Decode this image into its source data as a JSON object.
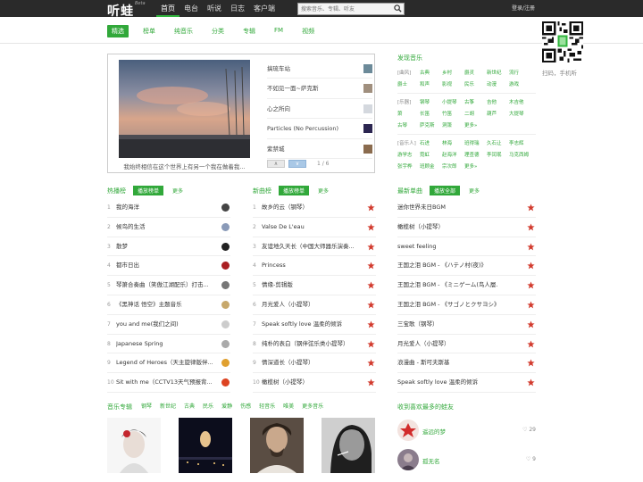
{
  "brand": {
    "logo": "听蛙",
    "beta": "Beta"
  },
  "topnav": [
    {
      "label": "首页",
      "active": true
    },
    {
      "label": "电台"
    },
    {
      "label": "听说"
    },
    {
      "label": "日志"
    },
    {
      "label": "客户端"
    }
  ],
  "search": {
    "placeholder": "搜索音乐、专辑、听友"
  },
  "login": "登录/注册",
  "subnav": [
    {
      "label": "精选",
      "active": true
    },
    {
      "label": "榜单"
    },
    {
      "label": "纯音乐"
    },
    {
      "label": "分类"
    },
    {
      "label": "专辑"
    },
    {
      "label": "FM"
    },
    {
      "label": "视频"
    }
  ],
  "qr": {
    "caption": "扫码，手机听"
  },
  "feature": {
    "caption": "我始终相信在这个世界上有另一个我在做着我...",
    "items": [
      "搞琉车站",
      "不如见一面~萨克斯",
      "心之所向",
      "Particles (No Percussion)",
      "紫禁城"
    ],
    "pager": {
      "prev": "∧",
      "next": "∨",
      "page": "1 / 6"
    }
  },
  "discover": {
    "title": "发现音乐",
    "groups": [
      [
        "[曲风]",
        "古典",
        "乡村",
        "爵灵",
        "新世纪",
        "流行",
        "爵士",
        "和声",
        "影视",
        "民乐",
        "动漫",
        "游戏"
      ],
      [
        "[乐器]",
        "钢琴",
        "小提琴",
        "古筝",
        "吉他",
        "木吉他",
        "箫",
        "长笛",
        "竹笛",
        "二胡",
        "葫芦",
        "大提琴",
        "古琴",
        "萨克斯",
        "洞箫",
        "更多»"
      ],
      [
        "[音乐人]",
        "石进",
        "林海",
        "班得瑞",
        "久石让",
        "李志辉",
        "游学志",
        "霓虹",
        "赵海洋",
        "理查德",
        "李闰珉",
        "马克西姆",
        "张宇桦",
        "班顾金",
        "宗次郎",
        "更多»"
      ]
    ]
  },
  "hot": {
    "title": "热播榜",
    "btn": "播放榜单",
    "more": "更多",
    "rows": [
      {
        "n": "1",
        "name": "我的海洋"
      },
      {
        "n": "2",
        "name": "候鸟的生活"
      },
      {
        "n": "3",
        "name": "散梦"
      },
      {
        "n": "4",
        "name": "都市日出"
      },
      {
        "n": "5",
        "name": "琴箫合奏曲（笑傲江湖配乐）打击..."
      },
      {
        "n": "6",
        "name": "《黑神话 悟空》主题音乐"
      },
      {
        "n": "7",
        "name": "you and me(我们之间)"
      },
      {
        "n": "8",
        "name": "Japanese Spring"
      },
      {
        "n": "9",
        "name": "Legend of Heroes（天主旋律版伴..."
      },
      {
        "n": "10",
        "name": "Sit with me（CCTV13天气预报背..."
      }
    ]
  },
  "newsongs": {
    "title": "新曲榜",
    "btn": "播放榜单",
    "more": "更多",
    "rows": [
      {
        "n": "1",
        "name": "故乡的云（钢琴）"
      },
      {
        "n": "2",
        "name": "Valse De L'eau"
      },
      {
        "n": "3",
        "name": "友谊地久天长（中国大师器乐演奏..."
      },
      {
        "n": "4",
        "name": "Princess"
      },
      {
        "n": "5",
        "name": "情缘-剪辑版"
      },
      {
        "n": "6",
        "name": "月光爱人（小提琴）"
      },
      {
        "n": "7",
        "name": "Speak softly love 温柔的倾诉"
      },
      {
        "n": "8",
        "name": "纯朴的表白（钢伴弦乐类小提琴）"
      },
      {
        "n": "9",
        "name": "情深道长（小提琴）"
      },
      {
        "n": "10",
        "name": "橄榄树（小提琴）"
      }
    ]
  },
  "singles": {
    "title": "最新单曲",
    "btn": "播放全部",
    "more": "更多",
    "rows": [
      {
        "name": "迷你世界未日BGM"
      },
      {
        "name": "橄榄树（小提琴）"
      },
      {
        "name": "sweet feeling"
      },
      {
        "name": "王国之泪 BGM - 《ハテノ村(夜)》"
      },
      {
        "name": "王国之泪 BGM - 《ミニゲーム(鸟人層..."
      },
      {
        "name": "王国之泪 BGM - 《サゴノとクサヨシ》"
      },
      {
        "name": "三宝歌（钢琴）"
      },
      {
        "name": "月光爱人（小提琴）"
      },
      {
        "name": "浪漫曲 - 斯可夫斯基"
      },
      {
        "name": "Speak softly love 温柔的倾诉"
      }
    ]
  },
  "albums": {
    "title": "音乐专辑",
    "genres": [
      "钢琴",
      "新世纪",
      "古典",
      "民乐",
      "爱静",
      "伤感",
      "轻音乐",
      "唯美",
      "更多音乐"
    ]
  },
  "friends": {
    "title": "收到喜欢最多的蛙友",
    "list": [
      {
        "name": "遥远的梦",
        "likes": "29"
      },
      {
        "name": "孤无名",
        "likes": "9"
      }
    ]
  }
}
